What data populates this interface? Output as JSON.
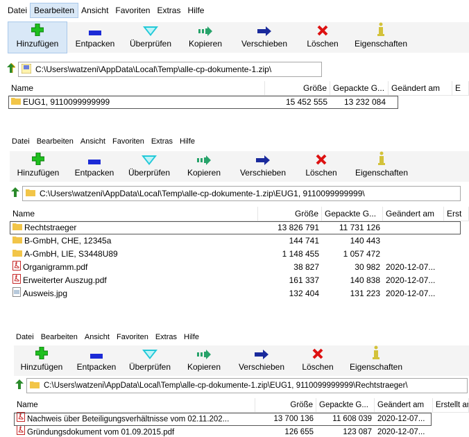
{
  "menu": [
    "Datei",
    "Bearbeiten",
    "Ansicht",
    "Favoriten",
    "Extras",
    "Hilfe"
  ],
  "toolbar": [
    {
      "label": "Hinzufügen",
      "icon": "plus-icon",
      "color": "#1fbf1f"
    },
    {
      "label": "Entpacken",
      "icon": "minus-icon",
      "color": "#1c2bd6"
    },
    {
      "label": "Überprüfen",
      "icon": "check-icon",
      "color": "#21c9d8"
    },
    {
      "label": "Kopieren",
      "icon": "copy-icon",
      "color": "#27a36a"
    },
    {
      "label": "Verschieben",
      "icon": "move-icon",
      "color": "#1a2a9c"
    },
    {
      "label": "Löschen",
      "icon": "delete-icon",
      "color": "#dd1111"
    },
    {
      "label": "Eigenschaften",
      "icon": "info-icon",
      "color": "#d3c23a"
    }
  ],
  "columns": {
    "name": "Name",
    "size": "Größe",
    "packed": "Gepackte G...",
    "modified": "Geändert am",
    "created_short": "E",
    "created_mid": "Erst",
    "created": "Erstellt am"
  },
  "panel1": {
    "path": "C:\\Users\\watzeni\\AppData\\Local\\Temp\\alle-cp-dokumente-1.zip\\",
    "rows": [
      {
        "name": "EUG1, 9110099999999",
        "size": "15 452 555",
        "packed": "13 232 084",
        "modified": "",
        "type": "folder"
      }
    ]
  },
  "panel2": {
    "path": "C:\\Users\\watzeni\\AppData\\Local\\Temp\\alle-cp-dokumente-1.zip\\EUG1, 9110099999999\\",
    "rows": [
      {
        "name": "Rechtstraeger",
        "size": "13 826 791",
        "packed": "11 731 126",
        "modified": "",
        "type": "folder"
      },
      {
        "name": "B-GmbH, CHE, 12345a",
        "size": "144 741",
        "packed": "140 443",
        "modified": "",
        "type": "folder"
      },
      {
        "name": "A-GmbH, LIE, S3448U89",
        "size": "1 148 455",
        "packed": "1 057 472",
        "modified": "",
        "type": "folder"
      },
      {
        "name": "Organigramm.pdf",
        "size": "38 827",
        "packed": "30 982",
        "modified": "2020-12-07...",
        "type": "pdf"
      },
      {
        "name": "Erweiterter Auszug.pdf",
        "size": "161 337",
        "packed": "140 838",
        "modified": "2020-12-07...",
        "type": "pdf"
      },
      {
        "name": "Ausweis.jpg",
        "size": "132 404",
        "packed": "131 223",
        "modified": "2020-12-07...",
        "type": "jpg"
      }
    ]
  },
  "panel3": {
    "path": "C:\\Users\\watzeni\\AppData\\Local\\Temp\\alle-cp-dokumente-1.zip\\EUG1, 9110099999999\\Rechtstraeger\\",
    "rows": [
      {
        "name": "Nachweis über Beteiligungsverhältnisse vom 02.11.202...",
        "size": "13 700 136",
        "packed": "11 608 039",
        "modified": "2020-12-07...",
        "type": "pdf"
      },
      {
        "name": "Gründungsdokument vom 01.09.2015.pdf",
        "size": "126 655",
        "packed": "123 087",
        "modified": "2020-12-07...",
        "type": "pdf"
      }
    ]
  }
}
